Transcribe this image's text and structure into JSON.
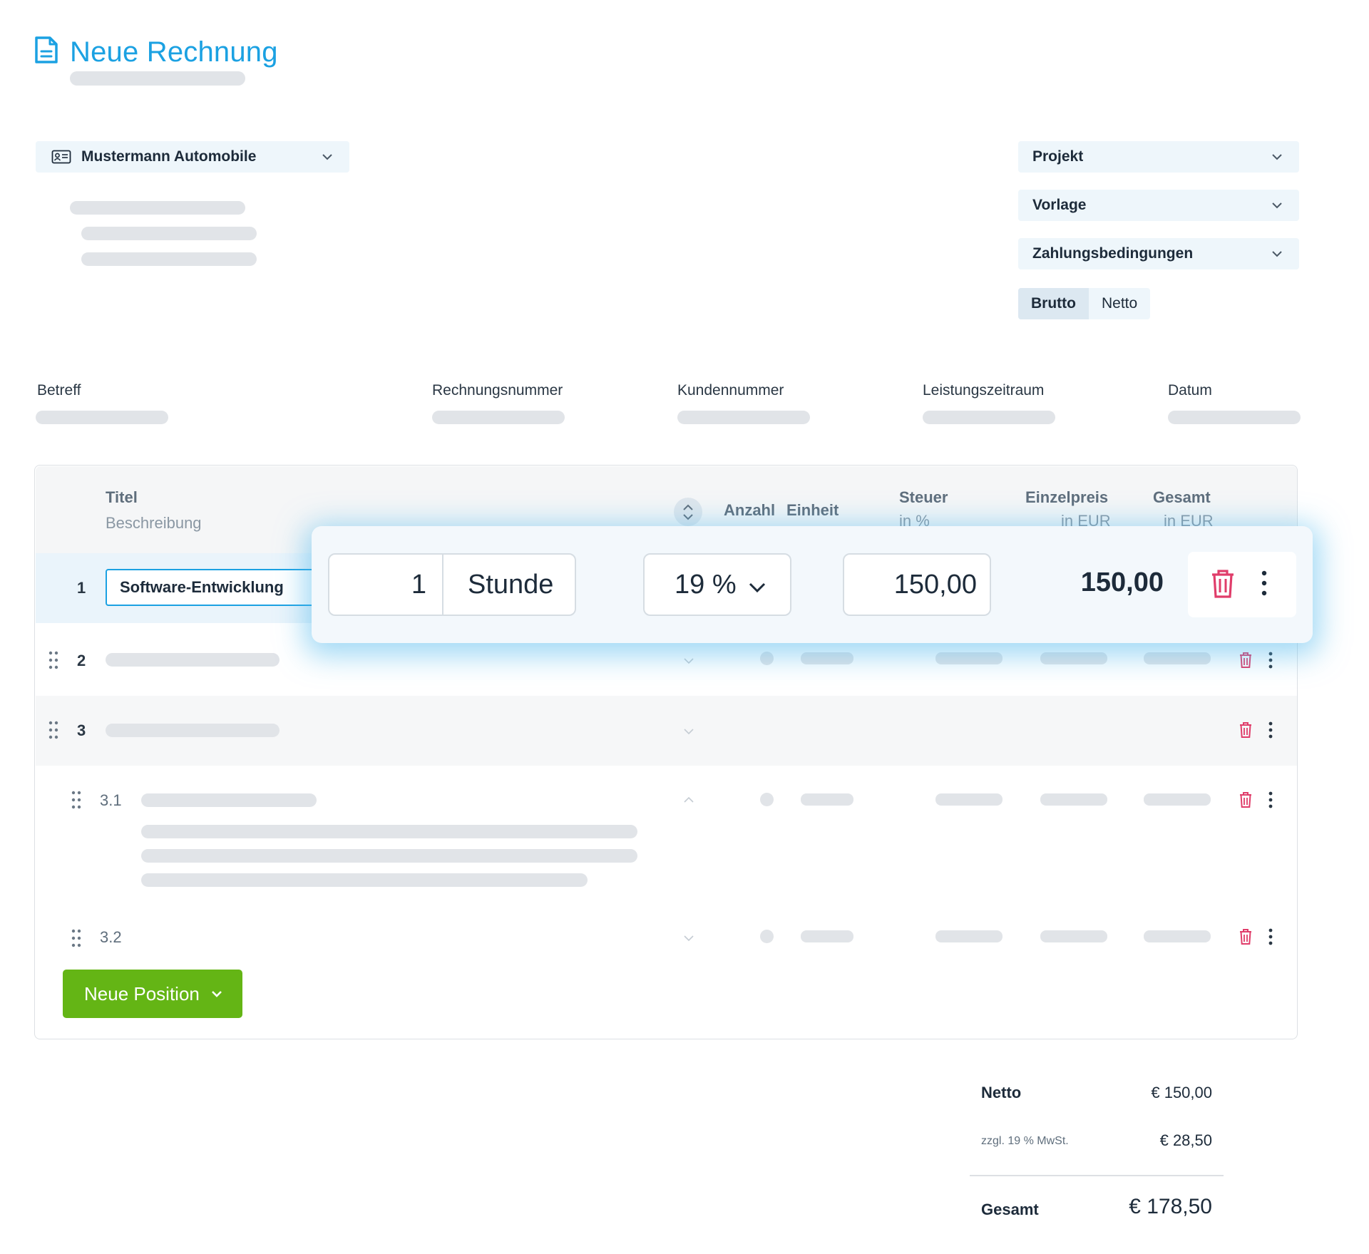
{
  "header": {
    "title": "Neue Rechnung",
    "icon": "document-icon"
  },
  "customer_select": {
    "value": "Mustermann Automobile",
    "icon": "contact-card-icon"
  },
  "right_selects": [
    {
      "label": "Projekt"
    },
    {
      "label": "Vorlage"
    },
    {
      "label": "Zahlungsbedingungen"
    }
  ],
  "price_mode": {
    "options": [
      "Brutto",
      "Netto"
    ],
    "selected": "Brutto"
  },
  "meta_fields": {
    "subject": "Betreff",
    "invoice_number": "Rechnungsnummer",
    "customer_number": "Kundennummer",
    "service_period": "Leistungszeitraum",
    "date": "Datum"
  },
  "table": {
    "headers": {
      "title": "Titel",
      "description": "Beschreibung",
      "quantity": "Anzahl",
      "unit": "Einheit",
      "tax": "Steuer",
      "tax_sub": "in %",
      "unit_price": "Einzelpreis",
      "unit_price_sub": "in EUR",
      "total": "Gesamt",
      "total_sub": "in EUR"
    },
    "rows": [
      {
        "number": "1",
        "title": "Software-Entwicklung",
        "quantity": "1",
        "unit": "Stunde",
        "tax": "19 %",
        "unit_price": "150,00",
        "total": "150,00"
      },
      {
        "number": "2"
      },
      {
        "number": "3"
      },
      {
        "number": "3.1"
      },
      {
        "number": "3.2"
      }
    ]
  },
  "new_position_button": "Neue Position",
  "totals": {
    "net_label": "Netto",
    "net_value": "€ 150,00",
    "vat_label": "zzgl. 19 % MwSt.",
    "vat_value": "€ 28,50",
    "gross_label": "Gesamt",
    "gross_value": "€ 178,50"
  },
  "colors": {
    "accent": "#1ba1e2",
    "button_green": "#64b515",
    "danger": "#e03d6a",
    "field_bg": "#eef6fb"
  }
}
